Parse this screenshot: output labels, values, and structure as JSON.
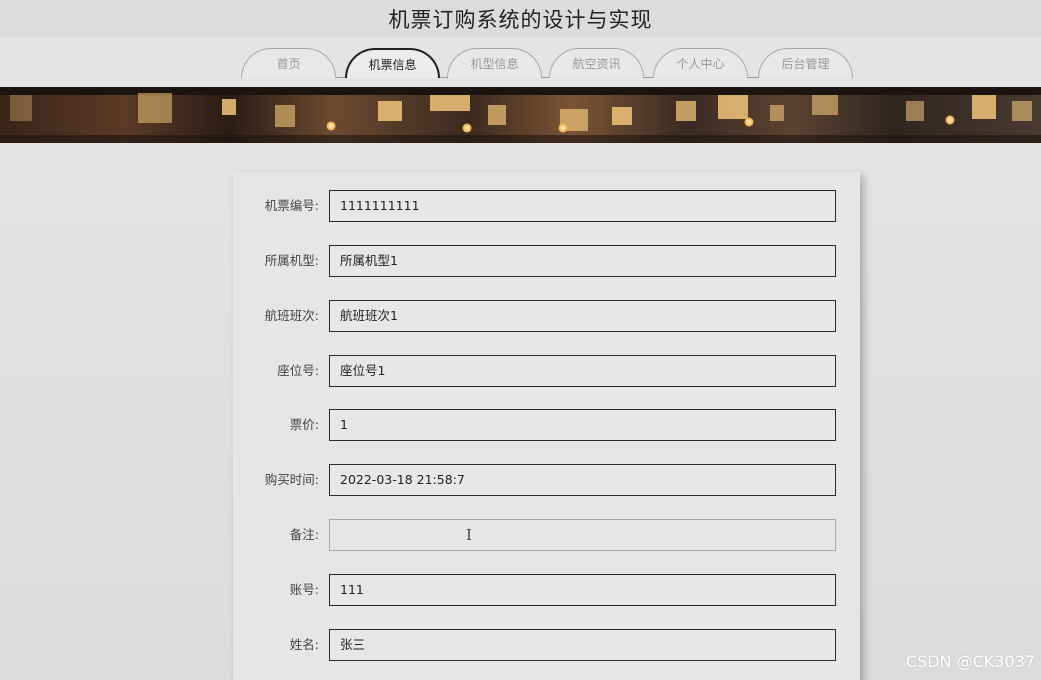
{
  "app": {
    "title": "机票订购系统的设计与实现"
  },
  "nav": {
    "tabs": [
      {
        "label": "首页"
      },
      {
        "label": "机票信息"
      },
      {
        "label": "机型信息"
      },
      {
        "label": "航空资讯"
      },
      {
        "label": "个人中心"
      },
      {
        "label": "后台管理"
      }
    ],
    "active_tab": "机票信息"
  },
  "form": {
    "fields": [
      {
        "label": "机票编号:",
        "value": "1111111111"
      },
      {
        "label": "所属机型:",
        "value": "所属机型1"
      },
      {
        "label": "航班班次:",
        "value": "航班班次1"
      },
      {
        "label": "座位号:",
        "value": "座位号1"
      },
      {
        "label": "票价:",
        "value": "1"
      },
      {
        "label": "购买时间:",
        "value": "2022-03-18 21:58:7"
      },
      {
        "label": "备注:",
        "value": ""
      },
      {
        "label": "账号:",
        "value": "111"
      },
      {
        "label": "姓名:",
        "value": "张三"
      }
    ]
  },
  "watermark": "CSDN @CK3037",
  "colors": {
    "active_tab_border": "#222222",
    "inactive_tab_text": "#999999",
    "field_border": "#2a2a2a"
  }
}
